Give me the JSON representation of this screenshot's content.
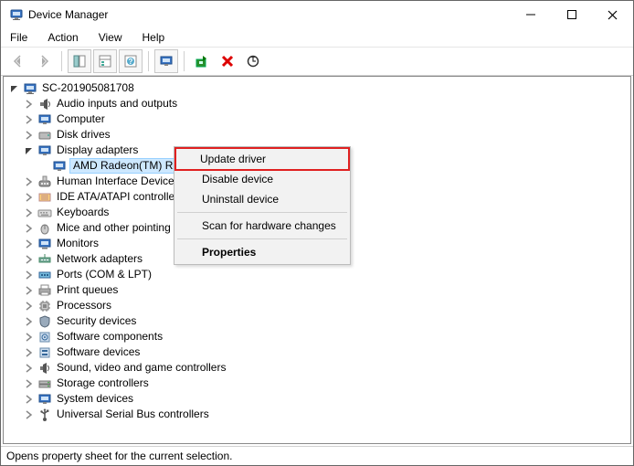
{
  "window": {
    "title": "Device Manager"
  },
  "menu": {
    "file": "File",
    "action": "Action",
    "view": "View",
    "help": "Help"
  },
  "toolbar_icons": {
    "back": "back-arrow",
    "fwd": "forward-arrow",
    "showhide": "show-hide-tree",
    "props": "properties",
    "help": "help-topics",
    "devices": "devices-view",
    "enable": "enable-device",
    "disable": "disable-device",
    "update": "update-driver",
    "uninstall": "uninstall-device",
    "scan": "scan-hardware"
  },
  "root": "SC-201905081708",
  "categories": {
    "audio": "Audio inputs and outputs",
    "computer": "Computer",
    "disk": "Disk drives",
    "display": "Display adapters",
    "hid": "Human Interface Devices",
    "ide": "IDE ATA/ATAPI controllers",
    "keyboards": "Keyboards",
    "mice": "Mice and other pointing devices",
    "monitors": "Monitors",
    "net": "Network adapters",
    "ports": "Ports (COM & LPT)",
    "printq": "Print queues",
    "proc": "Processors",
    "sec": "Security devices",
    "swc": "Software components",
    "swd": "Software devices",
    "sound": "Sound, video and game controllers",
    "storage": "Storage controllers",
    "sysdev": "System devices",
    "usb": "Universal Serial Bus controllers"
  },
  "display_child": "AMD Radeon(TM) RX Vega 11 Graphics",
  "context": {
    "update": "Update driver",
    "disable": "Disable device",
    "uninstall": "Uninstall device",
    "scan": "Scan for hardware changes",
    "props": "Properties"
  },
  "status": "Opens property sheet for the current selection."
}
